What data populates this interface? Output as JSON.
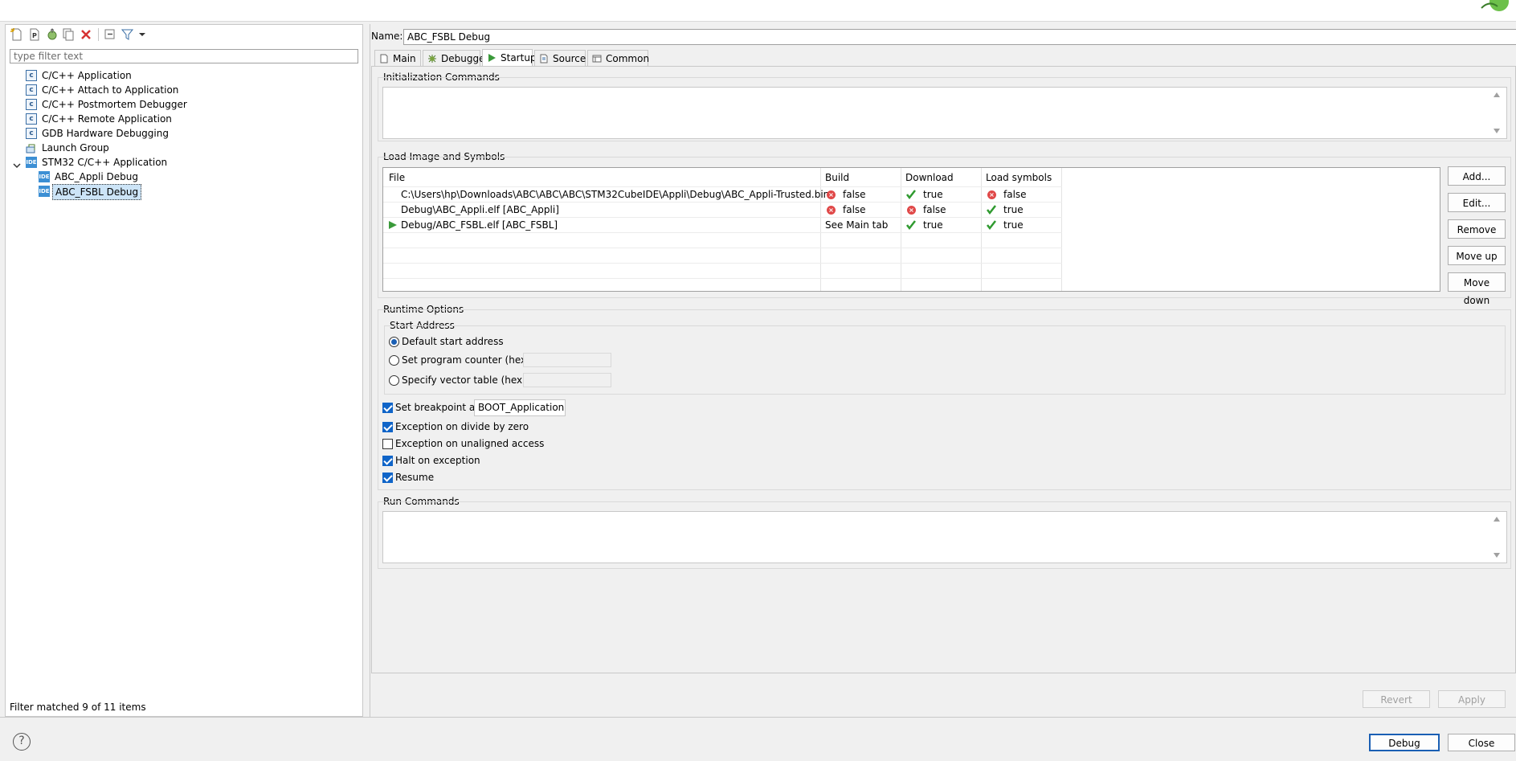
{
  "left": {
    "filter_placeholder": "type filter text",
    "tree": [
      {
        "label": "C/C++ Application",
        "icon": "c-app-icon"
      },
      {
        "label": "C/C++ Attach to Application",
        "icon": "c-app-icon"
      },
      {
        "label": "C/C++ Postmortem Debugger",
        "icon": "c-app-icon"
      },
      {
        "label": "C/C++ Remote Application",
        "icon": "c-app-icon"
      },
      {
        "label": "GDB Hardware Debugging",
        "icon": "c-app-icon"
      },
      {
        "label": "Launch Group",
        "icon": "launch-group-icon"
      },
      {
        "label": "STM32 C/C++ Application",
        "icon": "ide-icon",
        "expanded": true
      },
      {
        "label": "ABC_Appli Debug",
        "icon": "ide-icon"
      },
      {
        "label": "ABC_FSBL Debug",
        "icon": "ide-icon",
        "selected": true
      }
    ],
    "ide_badge": "IDE",
    "c_badge": "c",
    "status": "Filter matched 9 of 11 items"
  },
  "name_label": "Name:",
  "name_value": "ABC_FSBL Debug",
  "tabs": [
    {
      "label": "Main",
      "icon": "main-tab-icon"
    },
    {
      "label": "Debugger",
      "icon": "debugger-icon"
    },
    {
      "label": "Startup",
      "icon": "startup-play-icon",
      "active": true
    },
    {
      "label": "Source",
      "icon": "source-icon"
    },
    {
      "label": "Common",
      "icon": "common-icon"
    }
  ],
  "init_commands": {
    "title": "Initialization Commands"
  },
  "load_image": {
    "title": "Load Image and Symbols",
    "columns": [
      "File",
      "Build",
      "Download",
      "Load symbols"
    ],
    "rows": [
      {
        "file": "C:\\Users\\hp\\Downloads\\ABC\\ABC\\ABC\\STM32CubeIDE\\Appli\\Debug\\ABC_Appli-Trusted.bin",
        "build": "false",
        "build_ok": false,
        "download": "true",
        "download_ok": true,
        "symbols": "false",
        "symbols_ok": false,
        "main": false
      },
      {
        "file": "Debug\\ABC_Appli.elf [ABC_Appli]",
        "build": "false",
        "build_ok": false,
        "download": "false",
        "download_ok": false,
        "symbols": "true",
        "symbols_ok": true,
        "main": false
      },
      {
        "file": "Debug/ABC_FSBL.elf [ABC_FSBL]",
        "build": "See Main tab",
        "build_ok": null,
        "download": "true",
        "download_ok": true,
        "symbols": "true",
        "symbols_ok": true,
        "main": true
      }
    ],
    "buttons": {
      "add": "Add...",
      "edit": "Edit...",
      "remove": "Remove",
      "move_up": "Move up",
      "move_down": "Move down"
    }
  },
  "runtime": {
    "title": "Runtime Options",
    "start_address": {
      "title": "Start Address",
      "default": "Default start address",
      "pc": "Set program counter (hex):",
      "vector": "Specify vector table (hex):",
      "selected": "default"
    },
    "breakpoint_label": "Set breakpoint at:",
    "breakpoint_value": "BOOT_Application",
    "breakpoint_checked": true,
    "divide_zero": "Exception on divide by zero",
    "divide_zero_checked": true,
    "unaligned": "Exception on unaligned access",
    "unaligned_checked": false,
    "halt": "Halt on exception",
    "halt_checked": true,
    "resume": "Resume",
    "resume_checked": true
  },
  "run_commands": {
    "title": "Run Commands"
  },
  "footer": {
    "revert": "Revert",
    "apply": "Apply",
    "debug": "Debug",
    "close": "Close",
    "help": "?"
  }
}
